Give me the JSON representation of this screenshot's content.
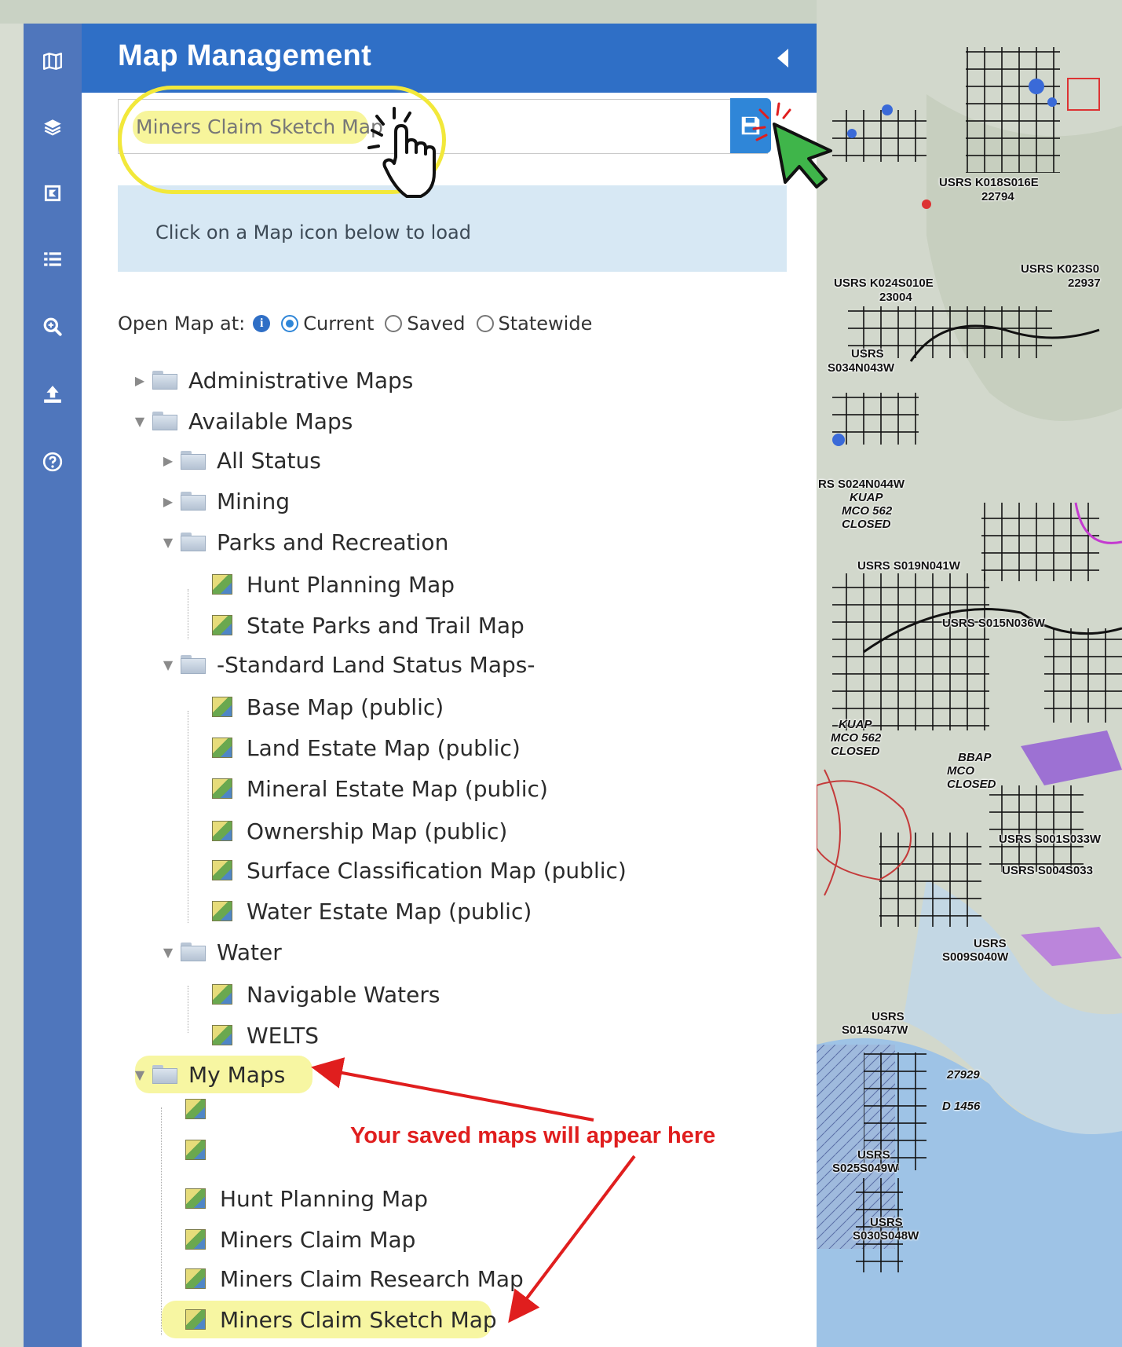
{
  "panel": {
    "title": "Map Management",
    "search": {
      "value": "Miners Claim Sketch Map"
    },
    "info_text": "Click on a Map icon below to load",
    "open_at": {
      "label": "Open Map at:",
      "options": [
        "Current",
        "Saved",
        "Statewide"
      ],
      "selected": "Current"
    }
  },
  "rail": {
    "icons": [
      "map-icon",
      "layers-icon",
      "draw-icon",
      "list-icon",
      "search-zoom-icon",
      "upload-icon",
      "help-icon"
    ]
  },
  "tree": {
    "administrative": "Administrative Maps",
    "available": "Available Maps",
    "all_status": "All Status",
    "mining": "Mining",
    "parks": "Parks and Recreation",
    "hunt_planning": "Hunt Planning Map",
    "state_parks": "State Parks and Trail Map",
    "standard": "-Standard Land Status Maps-",
    "base_map": "Base Map (public)",
    "land_estate": "Land Estate Map (public)",
    "mineral_estate": "Mineral Estate Map (public)",
    "ownership": "Ownership Map (public)",
    "surface_class": "Surface Classification Map (public)",
    "water_estate": "Water Estate Map (public)",
    "water": "Water",
    "navigable": "Navigable Waters",
    "welts": "WELTS",
    "my_maps": "My Maps",
    "my_hunt": "Hunt Planning Map",
    "my_miners": "Miners Claim Map",
    "my_research": "Miners Claim Research Map",
    "my_sketch": "Miners Claim Sketch Map"
  },
  "annotation": {
    "text": "Your saved maps will appear here",
    "color": "#e01e1e"
  },
  "map_labels": {
    "l1": "USRS K018S016E",
    "l1b": "22794",
    "l2": "USRS K023S0",
    "l2b": "22937",
    "l3": "USRS K024S010E",
    "l3b": "23004",
    "l4": "USRS",
    "l4b": "S034N043W",
    "l5": "RS S024N044W",
    "l5b": "KUAP",
    "l5c": "MCO 562",
    "l5d": "CLOSED",
    "l6": "USRS S019N041W",
    "l7": "USRS S015N036W",
    "l8": "USRS S001S033W",
    "l9": "USRS S004S033",
    "l10": "USRS",
    "l10b": "S009S040W",
    "l11": "USRS",
    "l11b": "S014S047W",
    "l12": "USRS",
    "l12b": "S025S049W",
    "l13": "USRS",
    "l13b": "S030S048W",
    "l14": "27929",
    "l15": "D 1456",
    "l16": "KUAP",
    "l16b": "MCO 562",
    "l16c": "CLOSED",
    "l17": "BBAP",
    "l17b": "MCO",
    "l17c": "CLOSED"
  }
}
